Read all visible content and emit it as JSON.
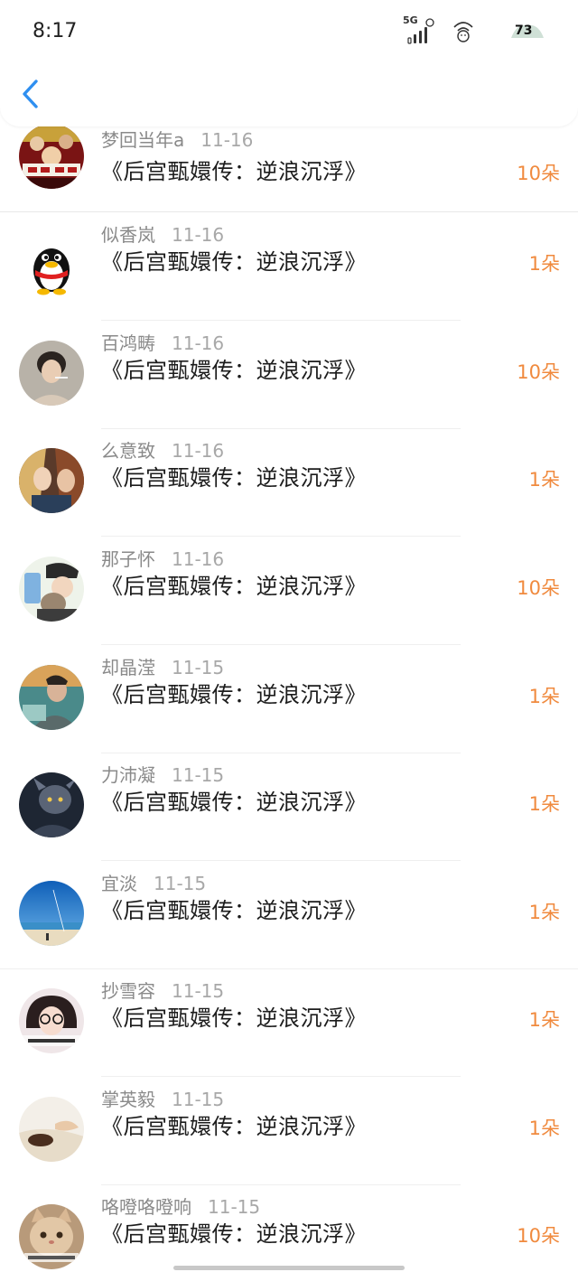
{
  "status_bar": {
    "time": "8:17",
    "signal_label": "5G",
    "battery": "73"
  },
  "header": {
    "back_icon": "chevron-left-icon"
  },
  "colors": {
    "accent_blue": "#2f8ff0",
    "count_orange": "#f08a3e"
  },
  "items": [
    {
      "name": "梦回当年a",
      "date": "11-16",
      "title": "《后宫甄嬛传：逆浪沉浮》",
      "count": "10朵",
      "avatar": "movie-poster-avatar"
    },
    {
      "name": "似香岚",
      "date": "11-16",
      "title": "《后宫甄嬛传：逆浪沉浮》",
      "count": "1朵",
      "avatar": "qq-penguin-avatar"
    },
    {
      "name": "百鸿畴",
      "date": "11-16",
      "title": "《后宫甄嬛传：逆浪沉浮》",
      "count": "10朵",
      "avatar": "photo-avatar"
    },
    {
      "name": "么意致",
      "date": "11-16",
      "title": "《后宫甄嬛传：逆浪沉浮》",
      "count": "1朵",
      "avatar": "photo-avatar"
    },
    {
      "name": "那子怀",
      "date": "11-16",
      "title": "《后宫甄嬛传：逆浪沉浮》",
      "count": "10朵",
      "avatar": "photo-avatar"
    },
    {
      "name": "却晶滢",
      "date": "11-15",
      "title": "《后宫甄嬛传：逆浪沉浮》",
      "count": "1朵",
      "avatar": "photo-avatar"
    },
    {
      "name": "力沛凝",
      "date": "11-15",
      "title": "《后宫甄嬛传：逆浪沉浮》",
      "count": "1朵",
      "avatar": "photo-avatar"
    },
    {
      "name": "宜淡",
      "date": "11-15",
      "title": "《后宫甄嬛传：逆浪沉浮》",
      "count": "1朵",
      "avatar": "beach-avatar"
    },
    {
      "name": "抄雪容",
      "date": "11-15",
      "title": "《后宫甄嬛传：逆浪沉浮》",
      "count": "1朵",
      "avatar": "photo-avatar"
    },
    {
      "name": "掌英毅",
      "date": "11-15",
      "title": "《后宫甄嬛传：逆浪沉浮》",
      "count": "1朵",
      "avatar": "photo-avatar"
    },
    {
      "name": "咯噔咯噔响",
      "date": "11-15",
      "title": "《后宫甄嬛传：逆浪沉浮》",
      "count": "10朵",
      "avatar": "cat-avatar"
    }
  ]
}
